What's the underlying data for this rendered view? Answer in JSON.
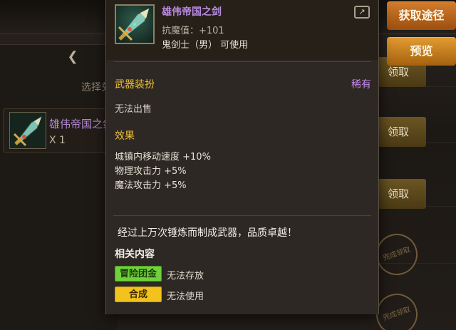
{
  "background": {
    "select_hint": "选择兑",
    "item_card": {
      "name": "雄伟帝国之剑",
      "count": "X 1"
    },
    "claim_label": "领取",
    "stamp_label": "完成领取",
    "side_buttons": {
      "source": "获取途径",
      "preview": "预览"
    }
  },
  "tooltip": {
    "item_name": "雄伟帝国之剑",
    "stat": "抗魔值：+101",
    "class_req": "鬼剑士（男） 可使用",
    "item_type": "武器装扮",
    "rarity": "稀有",
    "sell_status": "无法出售",
    "effect_title": "效果",
    "effects": [
      "城镇内移动速度 +10%",
      "物理攻击力 +5%",
      "魔法攻击力 +5%"
    ],
    "description": "经过上万次锤炼而制成武器，品质卓越！",
    "related_title": "相关内容",
    "related": [
      {
        "tag": "冒险团金库",
        "status": "无法存放"
      },
      {
        "tag": "合成",
        "status": "无法使用"
      }
    ]
  },
  "colors": {
    "name_purple": "#b98be0",
    "section_gold": "#f0c13a",
    "tag_green": "#6fd23a",
    "tag_yellow": "#f4c21c"
  },
  "icons": [
    "weapon-sword-icon",
    "share-icon",
    "back-arrow-icon"
  ]
}
